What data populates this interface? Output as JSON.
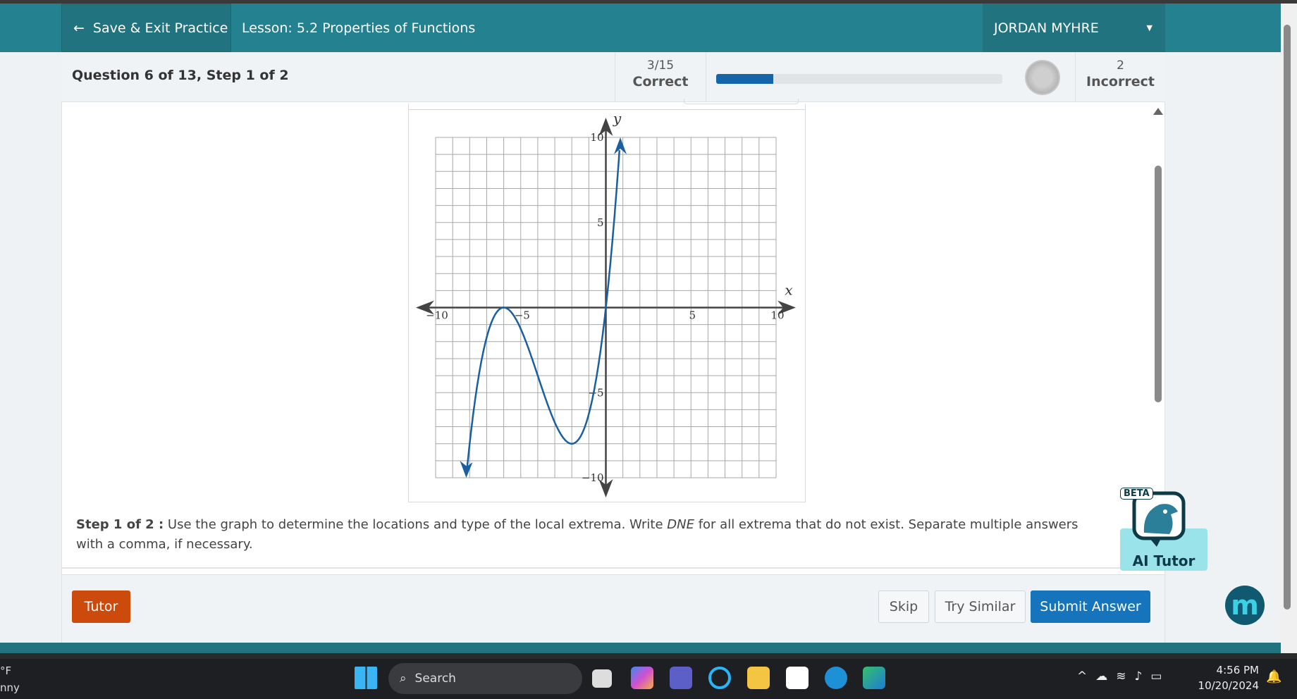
{
  "header": {
    "back_label": "Save & Exit Practice",
    "lesson": "Lesson: 5.2 Properties of Functions",
    "user": "JORDAN MYHRE"
  },
  "status": {
    "question": "Question 6 of 13,  Step 1 of 2",
    "correct_count": "3/15",
    "correct_label": "Correct",
    "incorrect_count": "2",
    "incorrect_label": "Incorrect",
    "progress_percent": 20
  },
  "chart_data": {
    "type": "line",
    "xlabel": "x",
    "ylabel": "y",
    "xlim": [
      -10,
      10
    ],
    "ylim": [
      -10,
      10
    ],
    "x_ticks": [
      "−10",
      "−5",
      "5",
      "10"
    ],
    "y_ticks": [
      "10",
      "5",
      "−5",
      "−10"
    ],
    "grid": true,
    "color": "#1a5fa0",
    "series": [
      {
        "x": [
          -8.3,
          -8,
          -7.5,
          -7,
          -6.5,
          -6,
          -5.5,
          -5,
          -4.5,
          -4,
          -3.5,
          -3,
          -2.5,
          -2,
          -1.5,
          -1,
          -0.5,
          0,
          0.3,
          0.6,
          0.85
        ],
        "y": [
          -11,
          -8,
          -4.2,
          -1.8,
          -0.4,
          0,
          -0.3,
          -1.3,
          -2.5,
          -4,
          -5.5,
          -6.8,
          -7.7,
          -8,
          -7.6,
          -6.3,
          -3.8,
          0,
          2.9,
          6.3,
          10
        ]
      }
    ],
    "local_max": [
      -6,
      0
    ],
    "local_min": [
      -2,
      -8
    ]
  },
  "step": {
    "prefix": "Step 1 of 2 :",
    "text_a": " Use the graph to determine the locations and type of the local extrema. Write ",
    "dne": "DNE",
    "text_b": " for all extrema that do not exist. Separate multiple answers with a comma, if necessary."
  },
  "footer": {
    "tutor": "Tutor",
    "skip": "Skip",
    "try_similar": "Try Similar",
    "submit": "Submit Answer"
  },
  "ai_tutor": {
    "beta": "BETA",
    "label": "AI Tutor"
  },
  "taskbar": {
    "weather_a": "°F",
    "weather_b": "nny",
    "search": "Search",
    "time": "4:56 PM",
    "date": "10/20/2024"
  }
}
